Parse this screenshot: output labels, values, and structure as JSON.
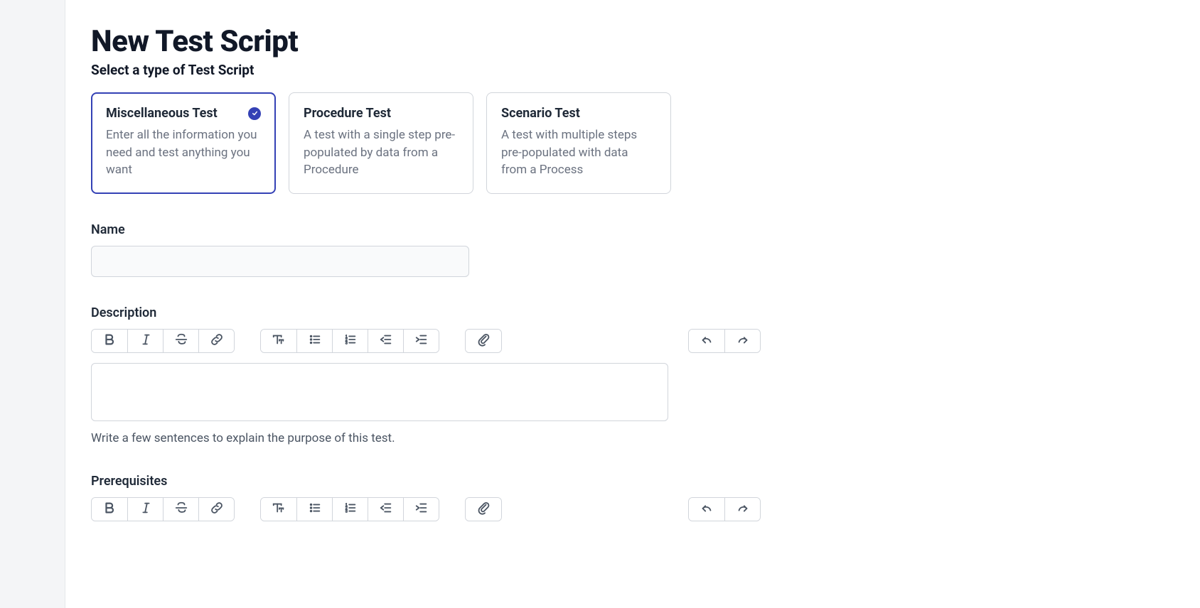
{
  "page": {
    "title": "New Test Script",
    "subtitle": "Select a type of Test Script"
  },
  "types": [
    {
      "title": "Miscellaneous Test",
      "desc": "Enter all the information you need and test anything you want",
      "selected": true
    },
    {
      "title": "Procedure Test",
      "desc": "A test with a single step pre-populated by data from a Procedure",
      "selected": false
    },
    {
      "title": "Scenario Test",
      "desc": "A test with multiple steps pre-populated with data from a Process",
      "selected": false
    }
  ],
  "fields": {
    "name": {
      "label": "Name",
      "value": ""
    },
    "description": {
      "label": "Description",
      "helper": "Write a few sentences to explain the purpose of this test.",
      "value": ""
    },
    "prerequisites": {
      "label": "Prerequisites",
      "value": ""
    }
  },
  "toolbar_icons": {
    "bold": "bold-icon",
    "italic": "italic-icon",
    "strike": "strikethrough-icon",
    "link": "link-icon",
    "textsize": "text-size-icon",
    "ulist": "bullet-list-icon",
    "olist": "numbered-list-icon",
    "outdent": "outdent-icon",
    "indent": "indent-icon",
    "attach": "attachment-icon",
    "undo": "undo-icon",
    "redo": "redo-icon"
  }
}
